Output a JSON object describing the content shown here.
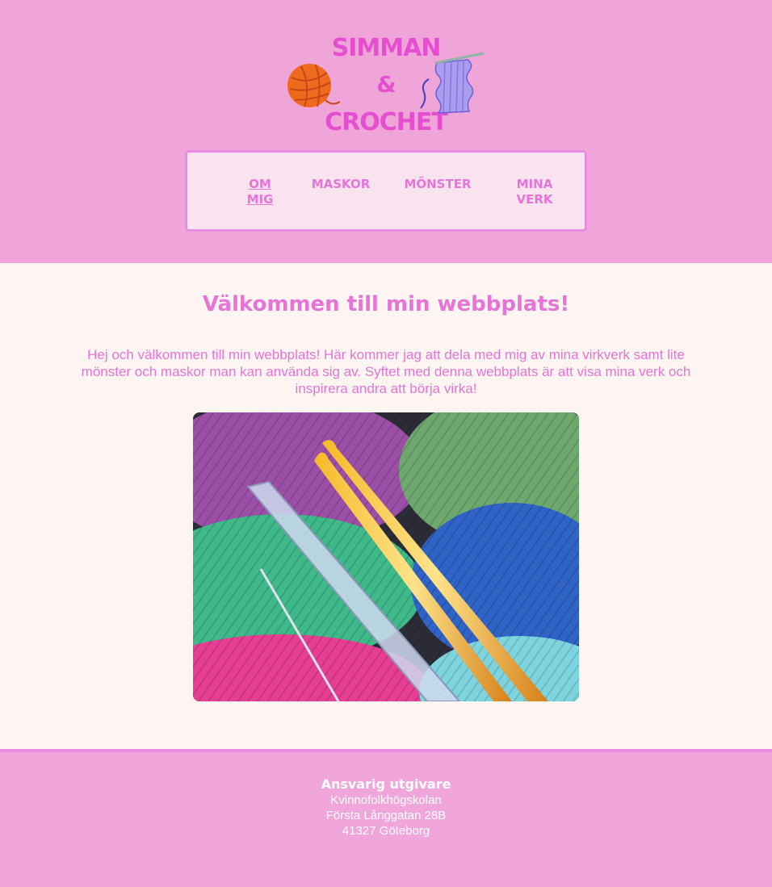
{
  "logo": {
    "line1": "SIMMAN",
    "line2": "&",
    "line3": "CROCHET",
    "icons": [
      "yarn-ball-icon",
      "crochet-piece-icon"
    ]
  },
  "nav": {
    "items": [
      {
        "label": "OM MIG",
        "active": true
      },
      {
        "label": "MASKOR",
        "active": false
      },
      {
        "label": "MÖNSTER",
        "active": false
      },
      {
        "label": "MINA VERK",
        "active": false
      }
    ]
  },
  "main": {
    "heading": "Välkommen till min webbplats!",
    "intro": "Hej och välkommen till min webbplats! Här kommer jag att dela med mig av mina virkverk samt lite mönster och maskor man kan använda sig av. Syftet med denna webbplats är att visa mina verk och inspirera andra att börja virka!"
  },
  "footer": {
    "title": "Ansvarig utgivare",
    "line1": "Kvinnofolkhögskolan",
    "line2": "Första Långgatan 28B",
    "line3": "41327 Göteborg"
  },
  "colors": {
    "background": "#f1a6db",
    "content_background": "#fdf5f1",
    "nav_background": "#f8e3ee",
    "accent": "#e574d6",
    "logo_text": "#e54fcf"
  }
}
